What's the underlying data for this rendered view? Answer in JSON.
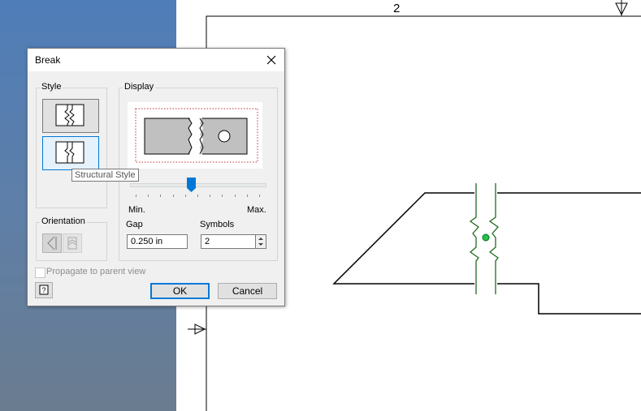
{
  "drawing": {
    "zone_number": "2"
  },
  "dialog": {
    "title": "Break",
    "style_group_label": "Style",
    "display_group_label": "Display",
    "tooltip": "Structural Style",
    "slider": {
      "min_label": "Min.",
      "max_label": "Max.",
      "value_fraction": 0.45
    },
    "orientation_label": "Orientation",
    "gap": {
      "label": "Gap",
      "value": "0.250 in"
    },
    "symbols": {
      "label": "Symbols",
      "value": "2"
    },
    "propagate_label": "Propagate to parent view",
    "ok_label": "OK",
    "cancel_label": "Cancel"
  },
  "colors": {
    "accent": "#0078d7",
    "canvas_bg": "#ffffff",
    "drawing_line": "#000000",
    "break_line": "#1f6b1f",
    "center_dot": "#22c24b"
  }
}
